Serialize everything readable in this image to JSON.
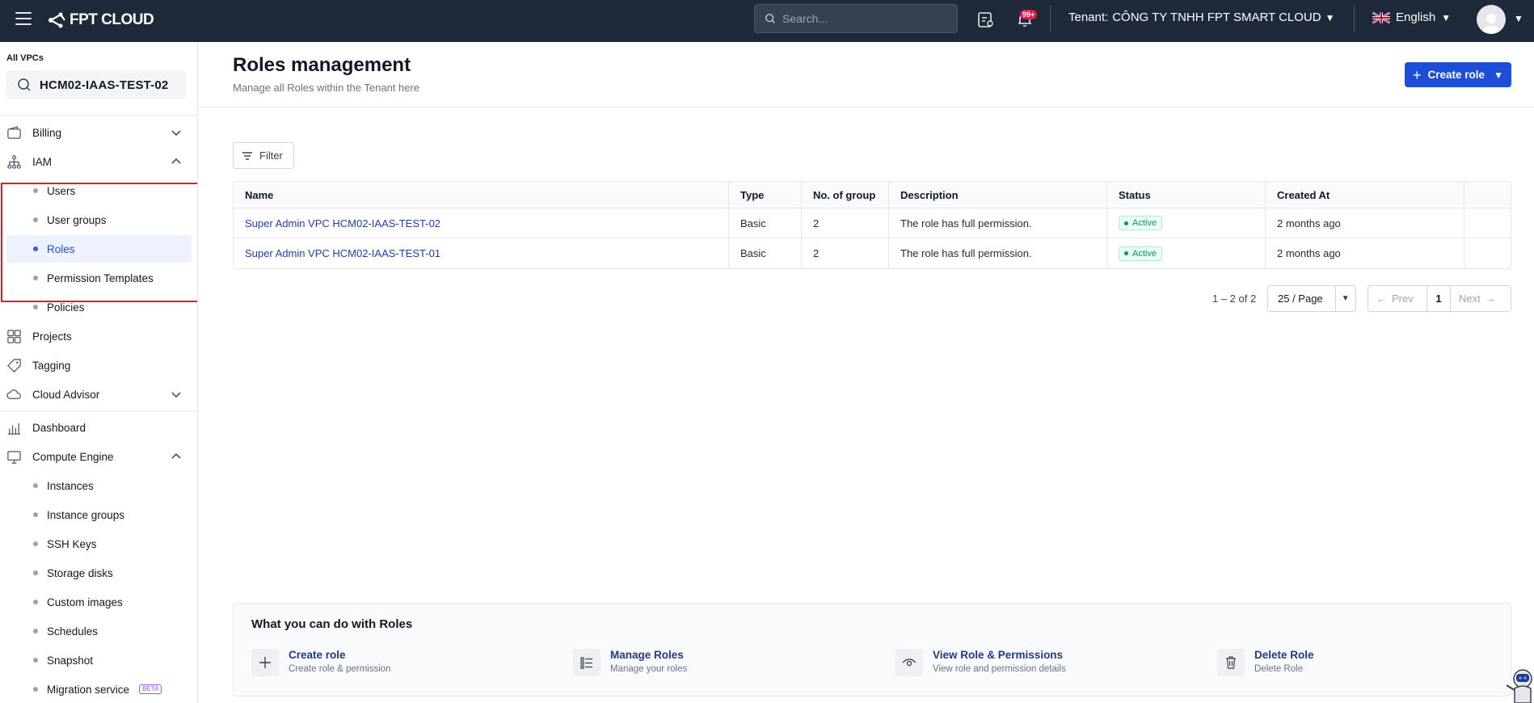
{
  "topbar": {
    "logo_text": "FPT CLOUD",
    "search_placeholder": "Search...",
    "notification_count": "99+",
    "tenant_label": "Tenant:",
    "tenant_name": "CÔNG TY TNHH FPT SMART CLOUD",
    "language": "English"
  },
  "sidebar": {
    "vpc_label": "All VPCs",
    "vpc_selected": "HCM02-IAAS-TEST-02",
    "billing": "Billing",
    "iam": "IAM",
    "iam_items": [
      "Users",
      "User groups",
      "Roles",
      "Permission Templates",
      "Policies"
    ],
    "projects": "Projects",
    "tagging": "Tagging",
    "cloud_advisor": "Cloud Advisor",
    "dashboard": "Dashboard",
    "compute_engine": "Compute Engine",
    "compute_items": [
      "Instances",
      "Instance groups",
      "SSH Keys",
      "Storage disks",
      "Custom images",
      "Schedules",
      "Snapshot",
      "Migration service"
    ],
    "beta_badge": "BETA"
  },
  "page": {
    "title": "Roles management",
    "subtitle": "Manage all Roles within the Tenant here",
    "create_button": "Create role",
    "filter_button": "Filter"
  },
  "table": {
    "headers": [
      "Name",
      "Type",
      "No. of group",
      "Description",
      "Status",
      "Created At"
    ],
    "rows": [
      {
        "name": "Super Admin VPC HCM02-IAAS-TEST-02",
        "type": "Basic",
        "groups": "2",
        "description": "The role has full permission.",
        "status": "Active",
        "created": "2 months ago"
      },
      {
        "name": "Super Admin VPC HCM02-IAAS-TEST-01",
        "type": "Basic",
        "groups": "2",
        "description": "The role has full permission.",
        "status": "Active",
        "created": "2 months ago"
      }
    ]
  },
  "pagination": {
    "range": "1 – 2 of 2",
    "page_size": "25 / Page",
    "prev": "Prev",
    "current": "1",
    "next": "Next"
  },
  "help": {
    "title": "What you can do with Roles",
    "items": [
      {
        "title": "Create role",
        "desc": "Create role & permission"
      },
      {
        "title": "Manage Roles",
        "desc": "Manage your roles"
      },
      {
        "title": "View Role & Permissions",
        "desc": "View role and permission details"
      },
      {
        "title": "Delete Role",
        "desc": "Delete Role"
      }
    ]
  },
  "colors": {
    "topbar_bg": "#1e2a3a",
    "primary": "#1d4ed8",
    "active_green": "#059669",
    "highlight_red": "#e11d1d"
  }
}
